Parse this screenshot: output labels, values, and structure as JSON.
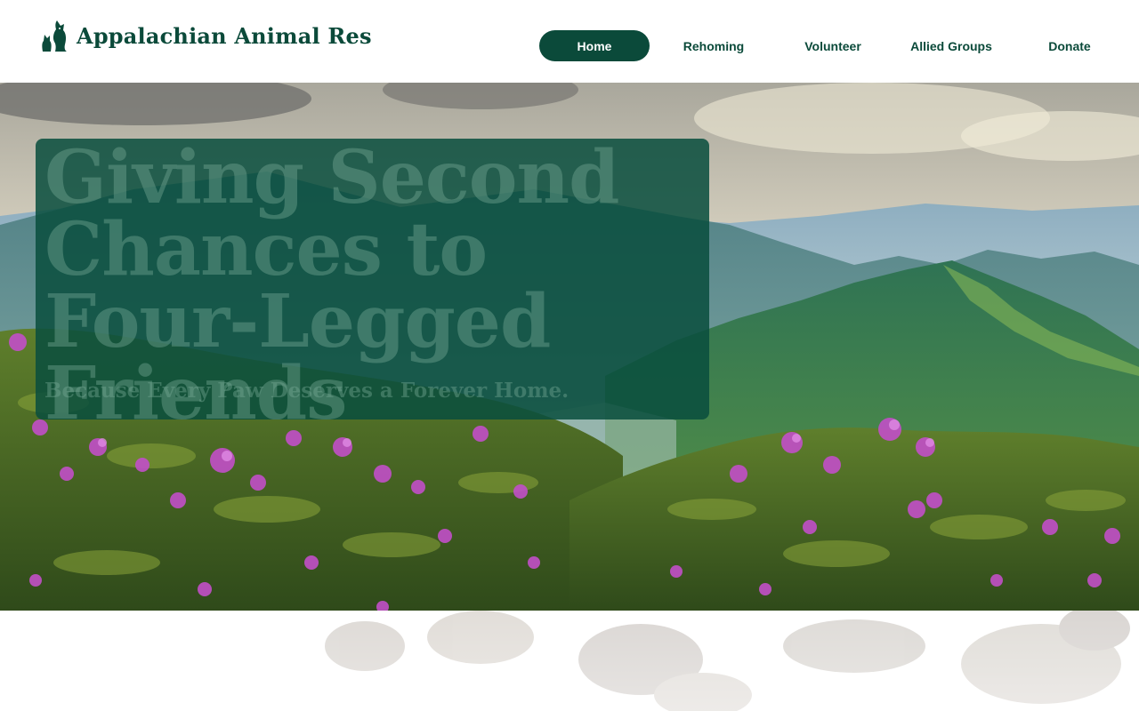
{
  "site": {
    "logo_text": "Appalachian Animal Res",
    "logo_icon": "dog-and-cat-icon"
  },
  "nav": {
    "items": [
      {
        "label": "Home",
        "active": true
      },
      {
        "label": "Rehoming",
        "active": false
      },
      {
        "label": "Volunteer",
        "active": false
      },
      {
        "label": "Allied Groups",
        "active": false
      },
      {
        "label": "Donate",
        "active": false
      }
    ]
  },
  "hero": {
    "title": "Giving Second Chances to Four-Legged Friends",
    "subtitle": "Because Every Paw Deserves a Forever Home."
  },
  "colors": {
    "brand": "#0b4a3a",
    "panel": "#094e3e",
    "flower": "#c24fc8"
  }
}
